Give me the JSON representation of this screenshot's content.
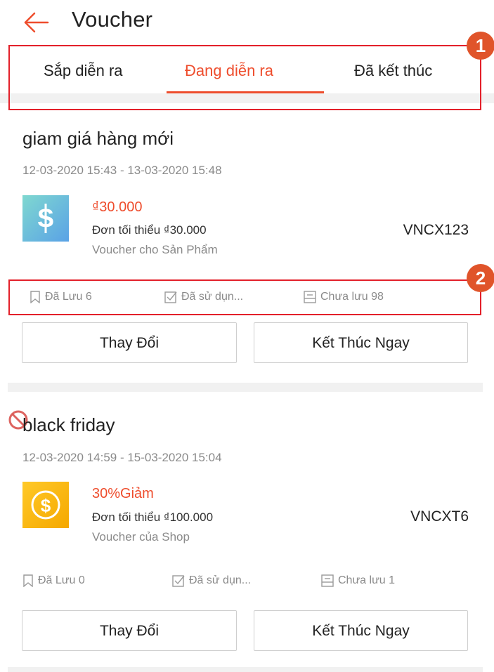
{
  "header": {
    "title": "Voucher"
  },
  "tabs": [
    {
      "label": "Sắp diễn ra",
      "active": false
    },
    {
      "label": "Đang diễn ra",
      "active": true
    },
    {
      "label": "Đã kết thúc",
      "active": false
    }
  ],
  "annotations": [
    "1",
    "2"
  ],
  "vouchers": [
    {
      "name": "giam giá hàng mới",
      "date_range": "12-03-2020 15:43 - 13-03-2020 15:48",
      "icon": "dollar-icon",
      "value": "₫30.000",
      "min_order": "Đơn tối thiểu ₫30.000",
      "type": "Voucher cho Sản Phẩm",
      "code": "VNCX123",
      "stats": {
        "saved": "Đã Lưu 6",
        "used": "Đã sử dụn...",
        "unsaved": "Chưa lưu 98"
      },
      "buttons": {
        "edit": "Thay Đổi",
        "end": "Kết Thúc Ngay"
      }
    },
    {
      "name": "black friday",
      "date_range": "12-03-2020 14:59 - 15-03-2020 15:04",
      "icon": "coin-dollar-icon",
      "value": "30%Giảm",
      "min_order": "Đơn tối thiểu ₫100.000",
      "type": "Voucher của Shop",
      "code": "VNCXT6",
      "stats": {
        "saved": "Đã Lưu 0",
        "used": "Đã sử dụn...",
        "unsaved": "Chưa lưu 1"
      },
      "buttons": {
        "edit": "Thay Đổi",
        "end": "Kết Thúc Ngay"
      }
    }
  ],
  "colors": {
    "accent": "#ee4d2d",
    "annotation": "#e3202a",
    "badge": "#e0542a",
    "product_voucher_gradient": [
      "#7fd8d0",
      "#5aa2e6"
    ],
    "shop_voucher": "#f7b500"
  }
}
